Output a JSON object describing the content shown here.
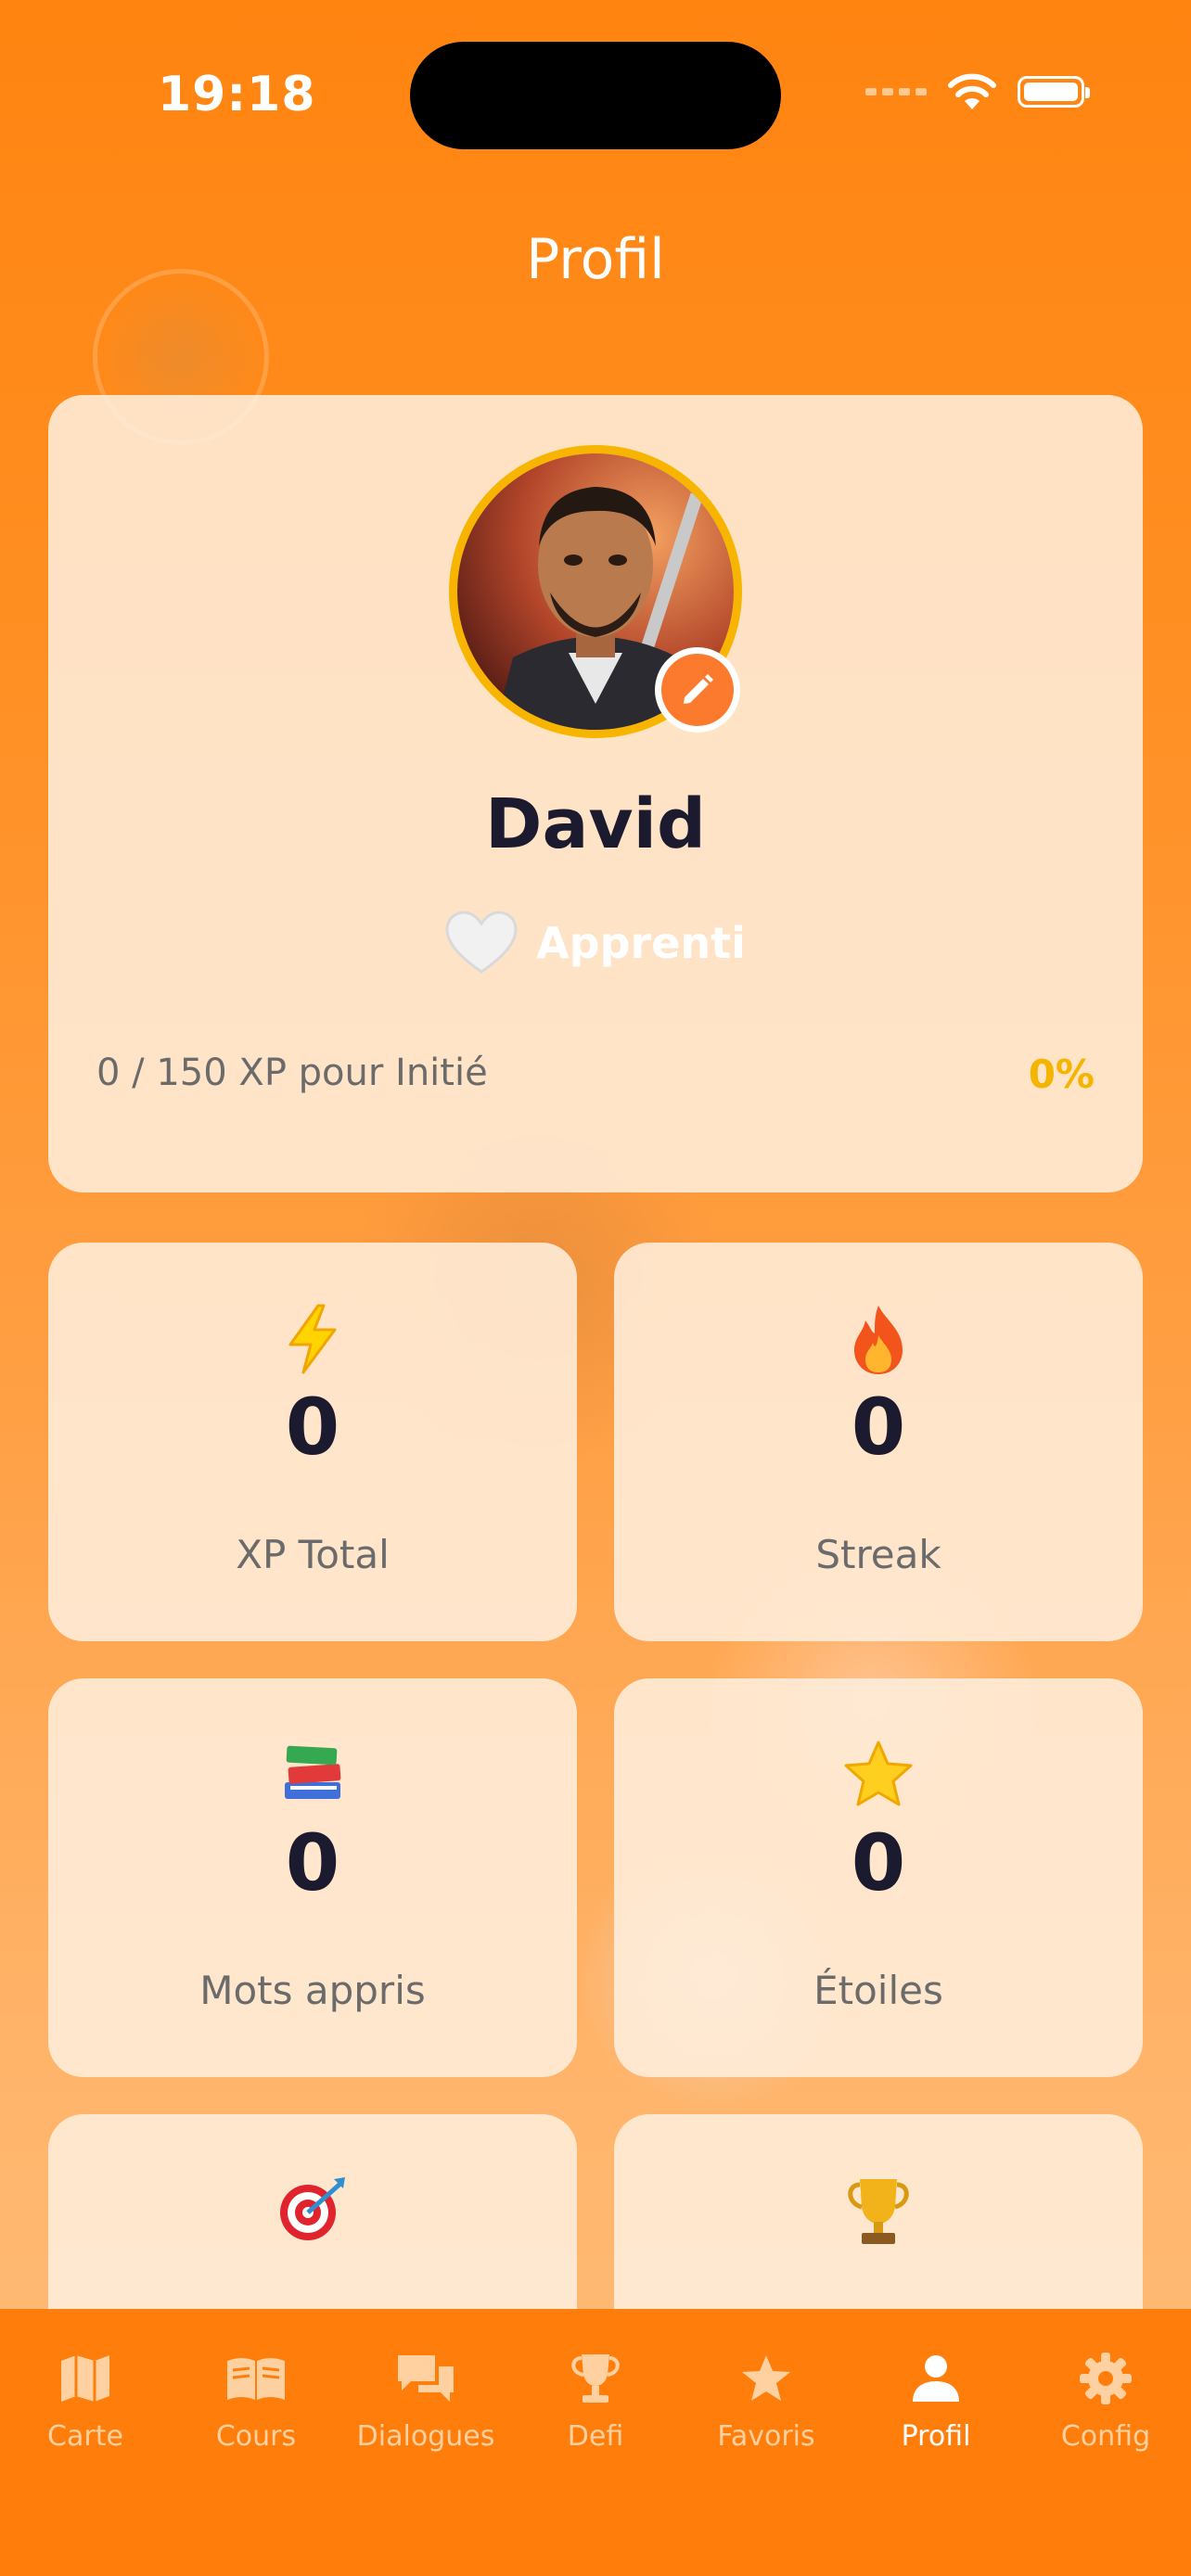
{
  "status_bar": {
    "time": "19:18"
  },
  "header": {
    "title": "Profil"
  },
  "profile": {
    "name": "David",
    "rank_label": "Apprenti",
    "xp_progress_text": "0 / 150 XP pour Initié",
    "xp_percent_text": "0%",
    "xp_progress_fraction": 0
  },
  "stats": [
    {
      "icon": "lightning-icon",
      "value": "0",
      "label": "XP Total"
    },
    {
      "icon": "fire-icon",
      "value": "0",
      "label": "Streak"
    },
    {
      "icon": "books-icon",
      "value": "0",
      "label": "Mots appris"
    },
    {
      "icon": "star-icon",
      "value": "0",
      "label": "Étoiles"
    },
    {
      "icon": "target-icon"
    },
    {
      "icon": "trophy-icon"
    }
  ],
  "tabbar": {
    "items": [
      {
        "icon": "map-icon",
        "label": "Carte"
      },
      {
        "icon": "book-icon",
        "label": "Cours"
      },
      {
        "icon": "chat-icon",
        "label": "Dialogues"
      },
      {
        "icon": "trophy-icon",
        "label": "Defi"
      },
      {
        "icon": "star-icon",
        "label": "Favoris"
      },
      {
        "icon": "person-icon",
        "label": "Profil",
        "active": true
      },
      {
        "icon": "gear-icon",
        "label": "Config"
      }
    ]
  },
  "colors": {
    "background_top": "#ff8410",
    "accent_gold": "#f7b500",
    "edit_button": "#fb7a2e",
    "text_dark": "#1b1a2e"
  }
}
